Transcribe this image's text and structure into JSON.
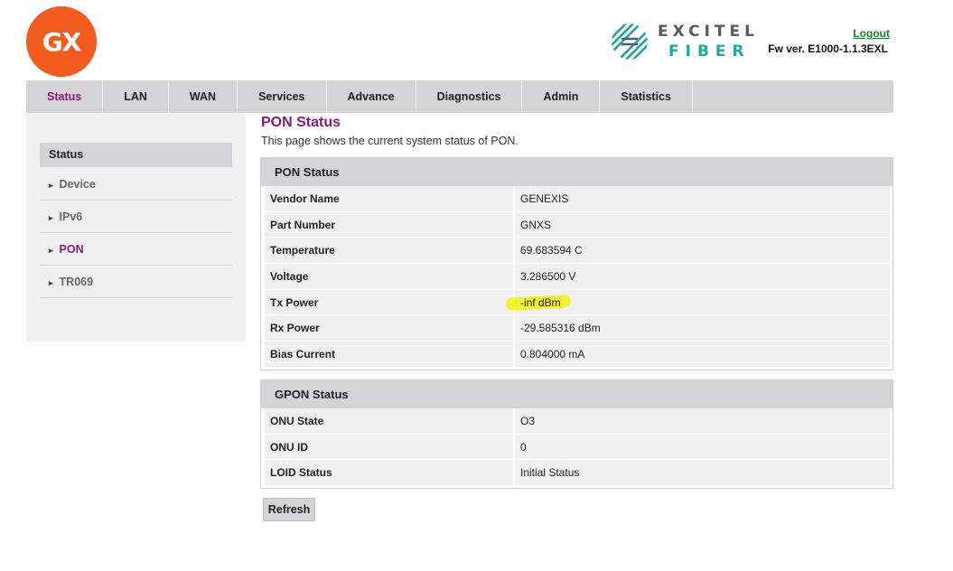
{
  "logo": {
    "text": "GX",
    "color": "#f25c1e"
  },
  "brand": {
    "line1": "EXCITEL",
    "line2": "FIBER",
    "icon": "excitel-fiber-logo-icon"
  },
  "header": {
    "logout_label": "Logout",
    "fw_version": "Fw ver. E1000-1.1.3EXL"
  },
  "nav": {
    "items": [
      {
        "label": "Status",
        "active": true
      },
      {
        "label": "LAN"
      },
      {
        "label": "WAN"
      },
      {
        "label": "Services"
      },
      {
        "label": "Advance"
      },
      {
        "label": "Diagnostics"
      },
      {
        "label": "Admin"
      },
      {
        "label": "Statistics"
      }
    ]
  },
  "sidebar": {
    "heading": "Status",
    "items": [
      {
        "label": "Device"
      },
      {
        "label": "IPv6"
      },
      {
        "label": "PON",
        "active": true
      },
      {
        "label": "TR069"
      }
    ]
  },
  "page": {
    "title": "PON Status",
    "description": "This page shows the current system status of PON."
  },
  "pon_status": {
    "heading": "PON Status",
    "rows": [
      {
        "key": "Vendor Name",
        "value": "GENEXIS"
      },
      {
        "key": "Part Number",
        "value": "GNXS"
      },
      {
        "key": "Temperature",
        "value": "69.683594 C"
      },
      {
        "key": "Voltage",
        "value": "3.286500 V"
      },
      {
        "key": "Tx Power",
        "value": "-inf dBm",
        "highlighted": true
      },
      {
        "key": "Rx Power",
        "value": "-29.585316 dBm"
      },
      {
        "key": "Bias Current",
        "value": "0.804000 mA"
      }
    ]
  },
  "gpon_status": {
    "heading": "GPON Status",
    "rows": [
      {
        "key": "ONU State",
        "value": "O3"
      },
      {
        "key": "ONU ID",
        "value": "0"
      },
      {
        "key": "LOID Status",
        "value": "Initial Status"
      }
    ]
  },
  "actions": {
    "refresh_label": "Refresh"
  },
  "colors": {
    "accent": "#8b1a7a",
    "highlight": "#f2f21a",
    "link": "#1a7d2a",
    "brand_teal": "#1ea8a4"
  }
}
